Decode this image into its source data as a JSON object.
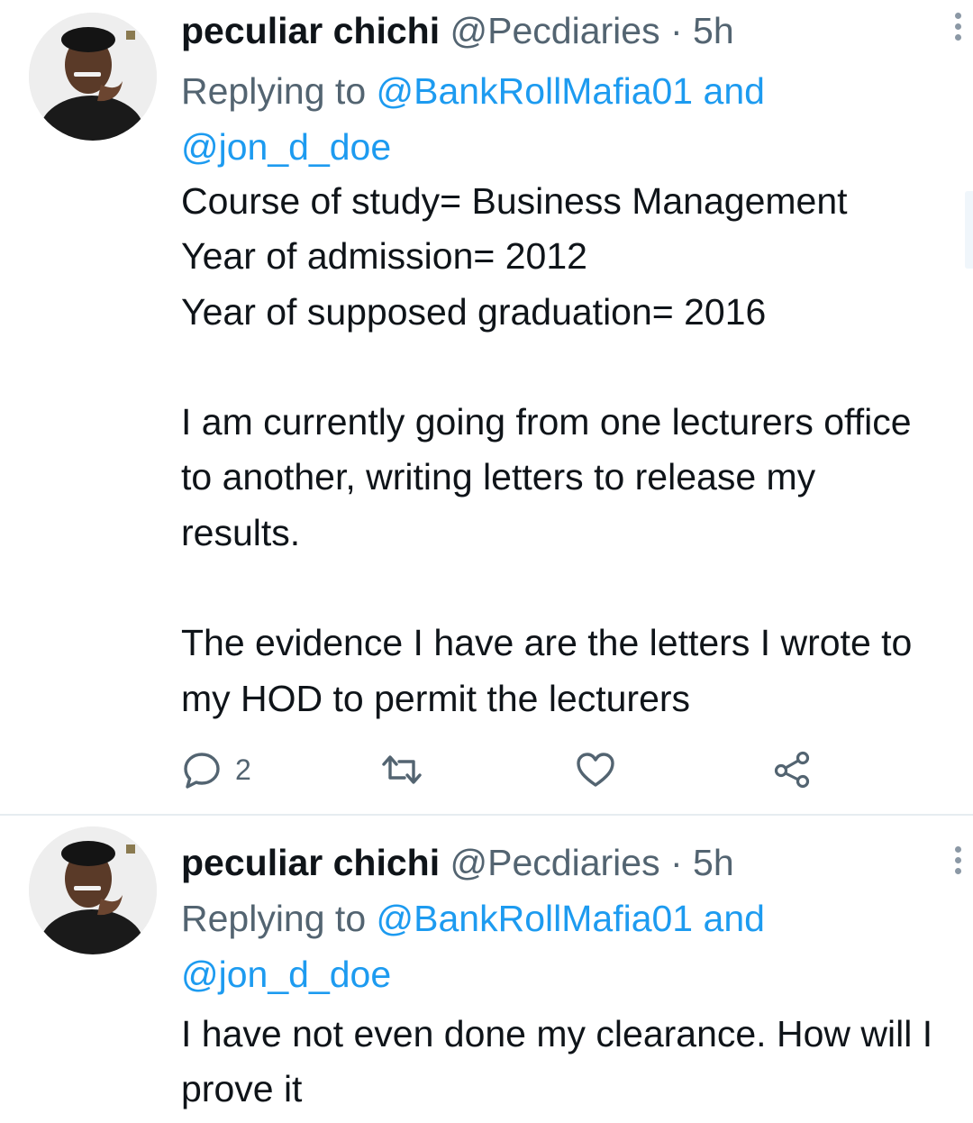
{
  "tweets": [
    {
      "author_name": "peculiar chichi",
      "author_handle": "@Pecdiaries",
      "separator": "·",
      "time": "5h",
      "replying_prefix": "Replying to",
      "reply_to_1": "@BankRollMafia01",
      "reply_conj": "and",
      "reply_to_2": "@jon_d_doe",
      "text": "Course of study= Business Management\nYear of admission= 2012\nYear of supposed graduation= 2016\n\nI am currently going from one lecturers office to another, writing letters to release my results.\n\nThe evidence I have are the letters I wrote to my HOD to permit the lecturers",
      "reply_count": "2",
      "icons": [
        "reply-icon",
        "retweet-icon",
        "like-icon",
        "share-icon"
      ]
    },
    {
      "author_name": "peculiar chichi",
      "author_handle": "@Pecdiaries",
      "separator": "·",
      "time": "5h",
      "replying_prefix": "Replying to",
      "reply_to_1": "@BankRollMafia01",
      "reply_conj": "and",
      "reply_to_2": "@jon_d_doe",
      "text": "I have not even done my clearance. How will I prove it"
    }
  ],
  "colors": {
    "link": "#1d9bf0",
    "secondary_text": "#536471",
    "primary_text": "#0f1419",
    "divider": "#e6ecf0"
  }
}
